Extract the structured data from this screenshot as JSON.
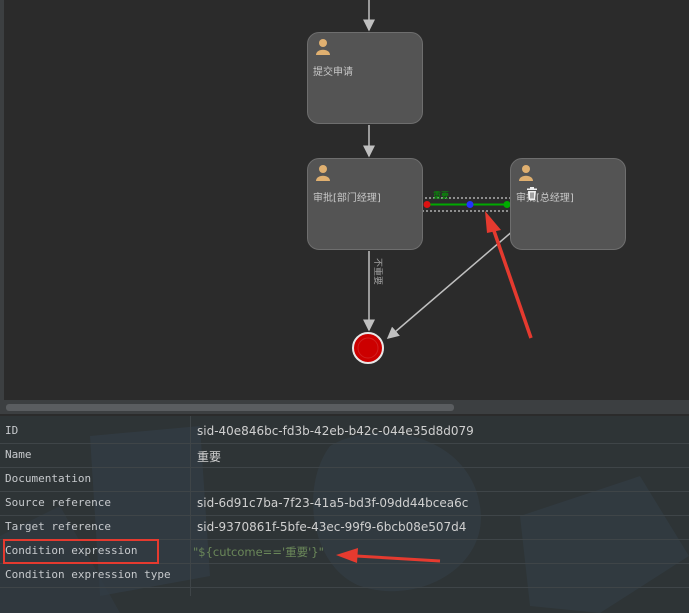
{
  "diagram": {
    "tasks": [
      {
        "id": "t1",
        "label": "提交申请"
      },
      {
        "id": "t2",
        "label": "审批[部门经理]"
      },
      {
        "id": "t3",
        "label": "审批[总经理]"
      }
    ],
    "flows": {
      "selected_label": "重要",
      "reject_label": "不重要"
    },
    "colors": {
      "background": "#2b2b2b",
      "task_fill": "#545454",
      "end_event": "#cc0000",
      "selection_green": "#00aa00",
      "annotation_red": "#e53a2f"
    }
  },
  "properties": {
    "rows": [
      {
        "key": "ID",
        "value": "sid-40e846bc-fd3b-42eb-b42c-044e35d8d079"
      },
      {
        "key": "Name",
        "value": "重要"
      },
      {
        "key": "Documentation",
        "value": ""
      },
      {
        "key": "Source reference",
        "value": "sid-6d91c7ba-7f23-41a5-bd3f-09dd44bcea6c"
      },
      {
        "key": "Target reference",
        "value": "sid-9370861f-5bfe-43ec-99f9-6bcb08e507d4"
      },
      {
        "key": "Condition expression",
        "value": "\"${cutcome=='重要'}\""
      },
      {
        "key": "Condition expression type",
        "value": ""
      }
    ]
  }
}
